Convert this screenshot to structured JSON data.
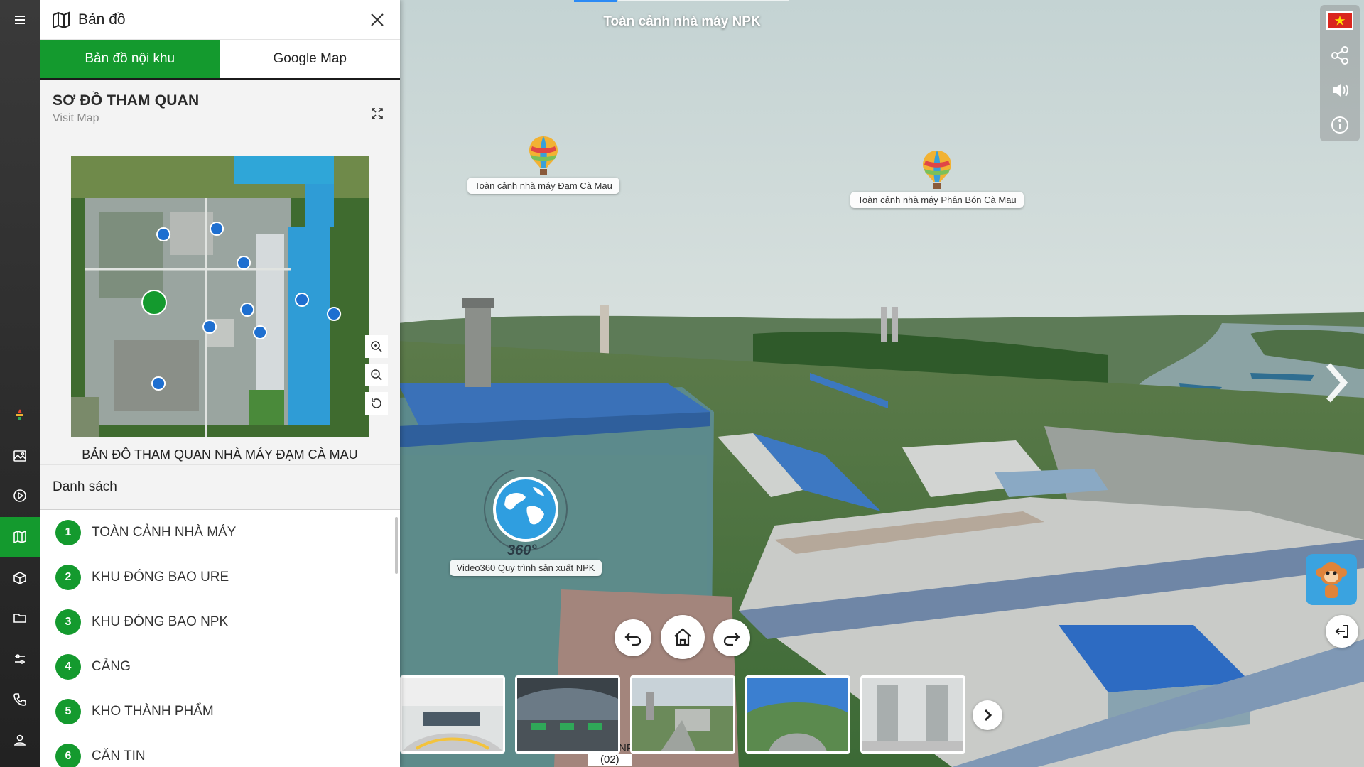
{
  "panel": {
    "title": "Bản đồ",
    "tabs": [
      "Bản đồ nội khu",
      "Google Map"
    ],
    "visit_title": "SƠ ĐỒ THAM QUAN",
    "visit_subtitle": "Visit Map",
    "map_caption": "BẢN ĐỒ THAM QUAN NHÀ MÁY ĐẠM CÀ MAU",
    "list_title": "Danh sách",
    "items": [
      {
        "num": "1",
        "label": "TOÀN CẢNH NHÀ MÁY"
      },
      {
        "num": "2",
        "label": "KHU ĐÓNG BAO URE"
      },
      {
        "num": "3",
        "label": "KHU ĐÓNG BAO NPK"
      },
      {
        "num": "4",
        "label": "CẢNG"
      },
      {
        "num": "5",
        "label": "KHO THÀNH PHẨM"
      },
      {
        "num": "6",
        "label": "CĂN TIN"
      }
    ]
  },
  "rail": {
    "icons": [
      "menu-icon",
      "logo-icon",
      "gallery-icon",
      "play-icon",
      "map-icon",
      "cube-icon",
      "folder-icon",
      "settings-sliders-icon",
      "phone-icon",
      "user-icon"
    ],
    "active": "map-icon"
  },
  "scene": {
    "title": "Toàn cảnh nhà máy NPK",
    "hotspots": {
      "dam": "Toàn cảnh nhà máy Đạm Cà Mau",
      "phanbon": "Toàn cảnh nhà máy Phân Bón Cà Mau",
      "video": "Video360 Quy trình sản xuất NPK",
      "badge360": "360°"
    },
    "thumb_caption_fragment": "NF",
    "thumb_caption_count": "(02)"
  },
  "colors": {
    "accent": "#149a2e",
    "rail_bg": "#2b2b2b",
    "flag_red": "#da251d",
    "flag_star": "#ffdd00"
  }
}
